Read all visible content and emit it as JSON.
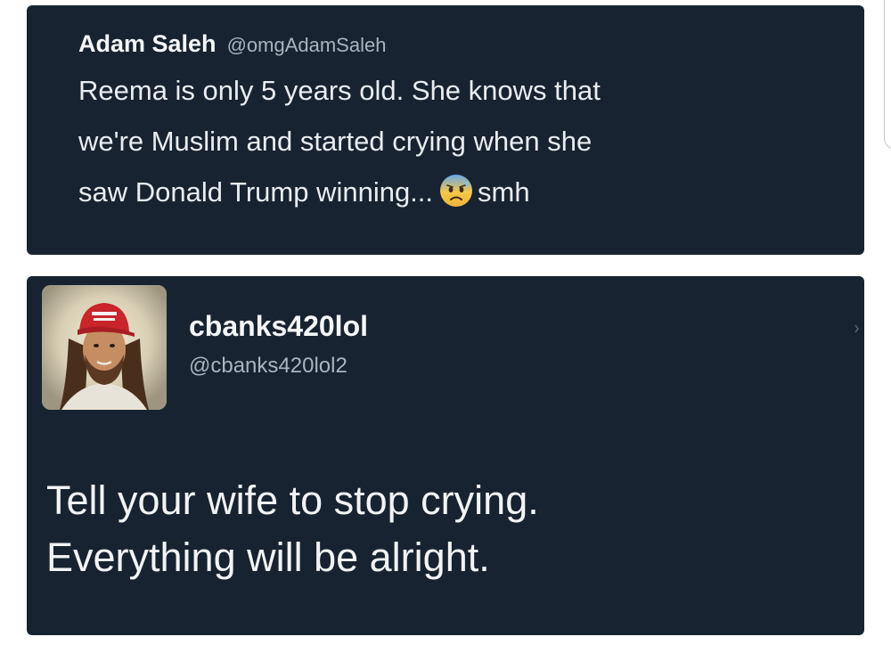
{
  "tweet_top": {
    "display_name": "Adam Saleh",
    "handle": "@omgAdamSaleh",
    "body_line1": "Reema is only 5 years old. She knows that",
    "body_line2": "we're Muslim and started crying when she",
    "body_line3_before_emoji": "saw Donald Trump winning...",
    "emoji": "anxious-face-with-sweat-emoji",
    "body_line3_after_emoji": "smh"
  },
  "tweet_bottom": {
    "display_name": "cbanks420lol",
    "handle": "@cbanks420lol2",
    "avatar": "profile-photo-red-cap",
    "body_line1": "Tell your wife to stop crying.",
    "body_line2": "Everything will be alright."
  },
  "colors": {
    "card_background": "#172331",
    "page_background": "#ffffff",
    "primary_text": "#e9edf1",
    "secondary_text": "#a9b4bf"
  }
}
